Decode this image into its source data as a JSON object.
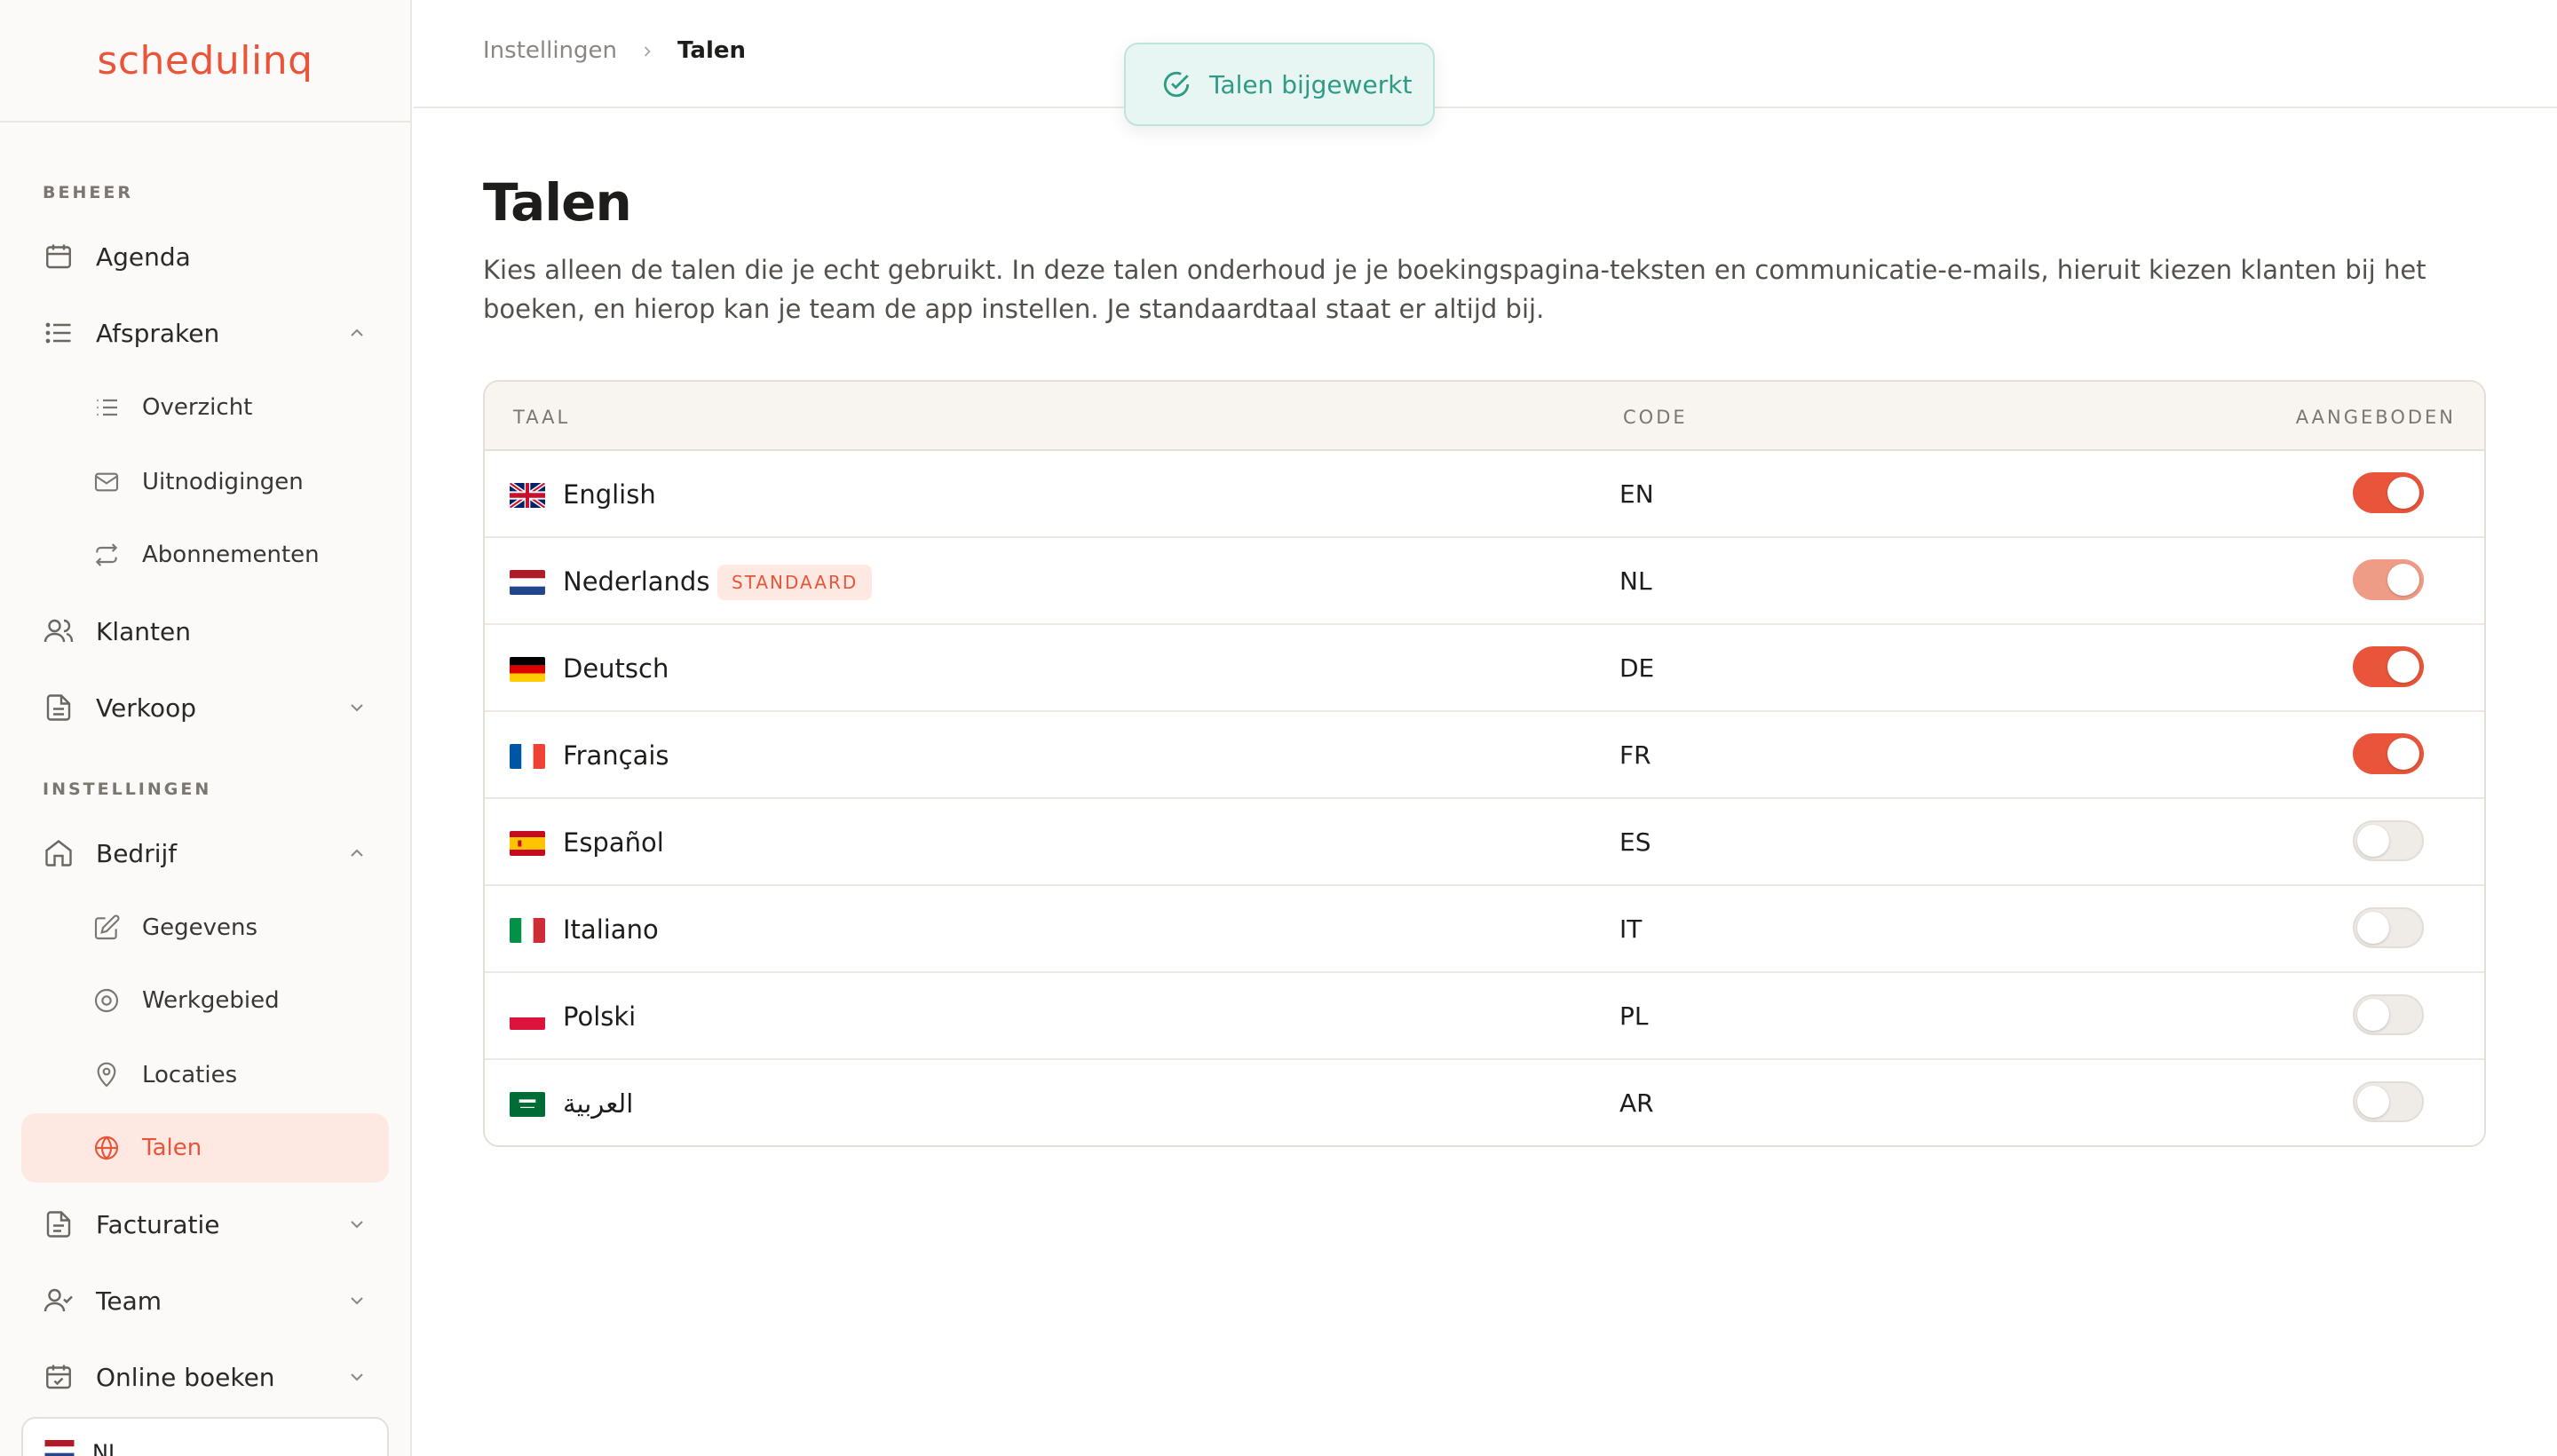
{
  "app": {
    "logo": "schedulinq"
  },
  "sidebar": {
    "sections": {
      "beheer": "BEHEER",
      "instellingen": "INSTELLINGEN"
    },
    "items": {
      "agenda": "Agenda",
      "afspraken": "Afspraken",
      "overzicht": "Overzicht",
      "uitnodigingen": "Uitnodigingen",
      "abonnementen": "Abonnementen",
      "klanten": "Klanten",
      "verkoop": "Verkoop",
      "bedrijf": "Bedrijf",
      "gegevens": "Gegevens",
      "werkgebied": "Werkgebied",
      "locaties": "Locaties",
      "talen": "Talen",
      "facturatie": "Facturatie",
      "team": "Team",
      "online_boeken": "Online boeken"
    },
    "active_item": "talen",
    "language_switch": {
      "value": "NL"
    }
  },
  "breadcrumb": {
    "parent": "Instellingen",
    "current": "Talen"
  },
  "toast": {
    "message": "Talen bijgewerkt",
    "color": "#2f9a86"
  },
  "page": {
    "title": "Talen",
    "description": "Kies alleen de talen die je echt gebruikt. In deze talen onderhoud je je boekingspagina-teksten en communicatie-e-mails, hieruit kiezen klanten bij het boeken, en hierop kan je team de app instellen. Je standaardtaal staat er altijd bij."
  },
  "table": {
    "headers": {
      "language": "TAAL",
      "code": "CODE",
      "offered": "AANGEBODEN"
    },
    "rows": [
      {
        "name": "English",
        "code": "EN",
        "flag": "flag-uk-icon",
        "offered": true,
        "default": false
      },
      {
        "name": "Nederlands",
        "code": "NL",
        "flag": "flag-nl-icon",
        "offered": true,
        "default": true,
        "badge": "STANDAARD"
      },
      {
        "name": "Deutsch",
        "code": "DE",
        "flag": "flag-de-icon",
        "offered": true,
        "default": false
      },
      {
        "name": "Français",
        "code": "FR",
        "flag": "flag-fr-icon",
        "offered": true,
        "default": false
      },
      {
        "name": "Español",
        "code": "ES",
        "flag": "flag-es-icon",
        "offered": false,
        "default": false
      },
      {
        "name": "Italiano",
        "code": "IT",
        "flag": "flag-it-icon",
        "offered": false,
        "default": false
      },
      {
        "name": "Polski",
        "code": "PL",
        "flag": "flag-pl-icon",
        "offered": false,
        "default": false
      },
      {
        "name": "العربية",
        "code": "AR",
        "flag": "flag-sa-icon",
        "offered": false,
        "default": false
      }
    ]
  },
  "colors": {
    "accent": "#e8553b",
    "accent_soft": "#fde9e2",
    "success": "#2f9a86"
  }
}
